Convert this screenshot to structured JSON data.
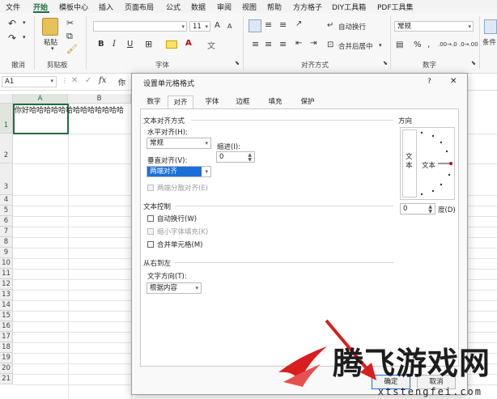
{
  "menu": {
    "items": [
      "文件",
      "开始",
      "模板中心",
      "插入",
      "页面布局",
      "公式",
      "数据",
      "审阅",
      "视图",
      "帮助",
      "方方格子",
      "DIY工具箱",
      "PDF工具集"
    ],
    "active_index": 1
  },
  "ribbon": {
    "groups": {
      "undo": "撤消",
      "clipboard": "剪贴板",
      "font": "字体",
      "alignment": "对齐方式",
      "number": "数字"
    },
    "paste_label": "粘贴",
    "font_size": "11",
    "font_size_up": "A",
    "font_size_down": "A",
    "bold": "B",
    "italic": "I",
    "underline": "U",
    "wrap_text": "自动换行",
    "merge_center": "合并后居中",
    "number_format": "常规",
    "conditional": "条件",
    "percent": "%",
    "comma": ",",
    "dec_inc": ".00→.0",
    "dec_dec": ".0→.00"
  },
  "formula_bar": {
    "name_box": "A1",
    "fx": "fx",
    "content": "你"
  },
  "sheet": {
    "columns": [
      "A",
      "B"
    ],
    "rows": [
      "1",
      "2",
      "3",
      "4",
      "5",
      "6",
      "7",
      "8",
      "9",
      "10",
      "11",
      "12",
      "13",
      "14",
      "15",
      "16",
      "17",
      "18",
      "19",
      "20",
      "21"
    ],
    "cell_a1": "你好哈哈哈哈哈哈哈哈哈哈哈哈哈"
  },
  "dialog": {
    "title": "设置单元格格式",
    "help": "?",
    "close": "✕",
    "tabs": [
      "数字",
      "对齐",
      "字体",
      "边框",
      "填充",
      "保护"
    ],
    "selected_tab": 1,
    "section_text_align": "文本对齐方式",
    "horizontal_label": "水平对齐(H):",
    "horizontal_value": "常规",
    "indent_label": "缩进(I):",
    "indent_value": "0",
    "vertical_label": "垂直对齐(V):",
    "vertical_value": "两端对齐",
    "distributed_label": "两端分散对齐(E)",
    "section_text_control": "文本控制",
    "wrap_label": "自动换行(W)",
    "shrink_label": "缩小字体填充(K)",
    "merge_label": "合并单元格(M)",
    "section_rtl": "从右到左",
    "direction_label": "文字方向(T):",
    "direction_value": "根据内容",
    "orientation_label": "方向",
    "vertical_text": "文本",
    "horizontal_text": "文本",
    "degree_value": "0",
    "degree_label": "度(D)",
    "ok": "确定",
    "cancel": "取消"
  },
  "watermark": {
    "title": "腾飞游戏网",
    "url": "xtstengfei.com"
  }
}
